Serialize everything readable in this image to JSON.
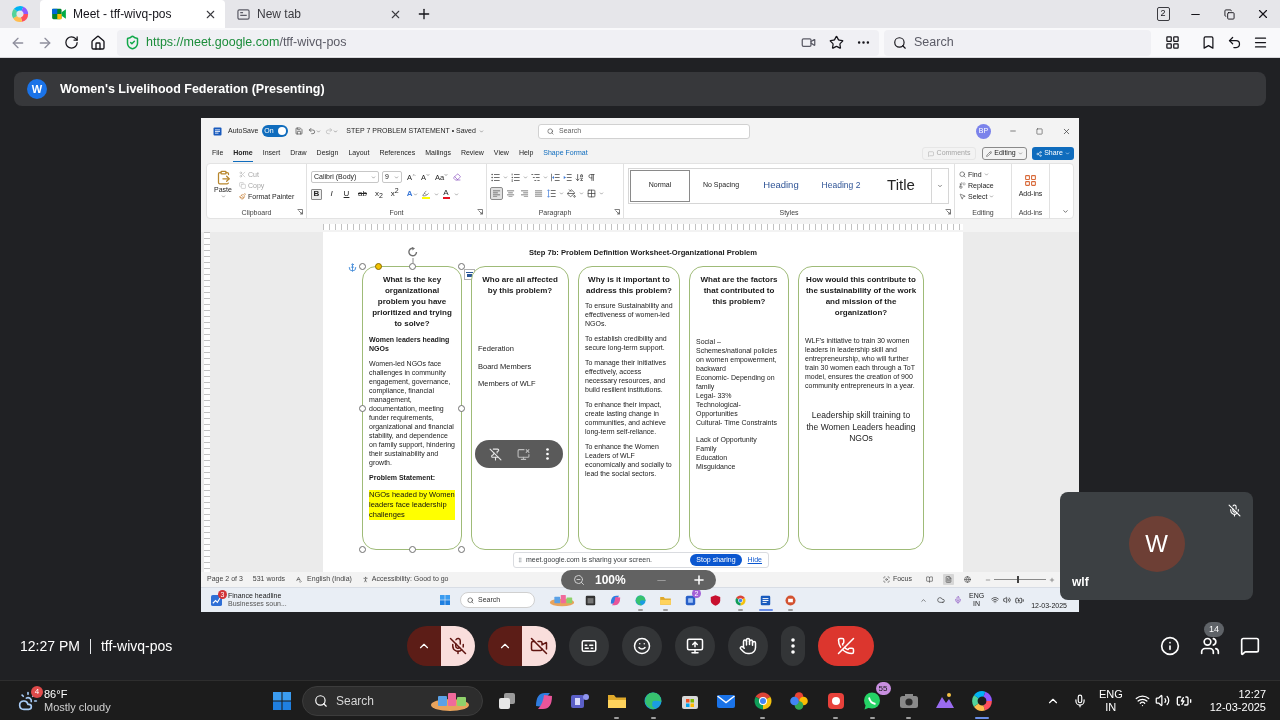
{
  "browser": {
    "tabs": [
      {
        "title": "Meet - tff-wivq-pos",
        "kind": "meet",
        "selected": true
      },
      {
        "title": "New tab",
        "kind": "blank",
        "selected": false
      }
    ],
    "tab_count": "2",
    "url_origin": "https://meet.google.com",
    "url_path": "/tff-wivq-pos",
    "search_placeholder": "Search"
  },
  "meeting": {
    "presenter_initial": "W",
    "title": "Women's Livelihood Federation (Presenting)",
    "time": "12:27 PM",
    "code": "tff-wivq-pos",
    "participant_count": "14",
    "controls": [
      {
        "kind": "mic",
        "on": false
      },
      {
        "kind": "camera",
        "on": false
      },
      {
        "kind": "captions",
        "on": false
      },
      {
        "kind": "reactions",
        "on": false
      },
      {
        "kind": "present",
        "on": false
      },
      {
        "kind": "hand",
        "on": false
      },
      {
        "kind": "more",
        "on": false
      }
    ]
  },
  "participant": {
    "initial": "W",
    "name": "wlf",
    "muted": true
  },
  "share_bar": {
    "message": "meet.google.com is sharing your screen.",
    "stop": "Stop sharing",
    "hide": "Hide"
  },
  "zoom_indicator": "100%",
  "word": {
    "autosave_label": "AutoSave",
    "autosave_on": true,
    "autosave_state": "On",
    "doc_title": "STEP 7 PROBLEM STATEMENT • Saved",
    "search_placeholder": "Search",
    "user_initials": "BP",
    "tabs": [
      {
        "label": "File",
        "selected": false,
        "contextual": false
      },
      {
        "label": "Home",
        "selected": true,
        "contextual": false
      },
      {
        "label": "Insert",
        "selected": false,
        "contextual": false
      },
      {
        "label": "Draw",
        "selected": false,
        "contextual": false
      },
      {
        "label": "Design",
        "selected": false,
        "contextual": false
      },
      {
        "label": "Layout",
        "selected": false,
        "contextual": false
      },
      {
        "label": "References",
        "selected": false,
        "contextual": false
      },
      {
        "label": "Mailings",
        "selected": false,
        "contextual": false
      },
      {
        "label": "Review",
        "selected": false,
        "contextual": false
      },
      {
        "label": "View",
        "selected": false,
        "contextual": false
      },
      {
        "label": "Help",
        "selected": false,
        "contextual": false
      },
      {
        "label": "Shape Format",
        "selected": false,
        "contextual": true
      }
    ],
    "comments": {
      "label": "Comments",
      "disabled": true
    },
    "mode": "Editing",
    "share": "Share",
    "clipboard": {
      "label": "Clipboard",
      "paste": "Paste",
      "tools": [
        {
          "label": "Cut",
          "kind": "cut",
          "disabled": true
        },
        {
          "label": "Copy",
          "kind": "copy",
          "disabled": true
        },
        {
          "label": "Format Painter",
          "kind": "painter",
          "disabled": false
        }
      ]
    },
    "font": {
      "label": "Font",
      "family": "Calibri (Body)",
      "size": "9",
      "size_tools": [
        {
          "label": "A",
          "kind": "grow"
        },
        {
          "label": "A",
          "kind": "shrink"
        },
        {
          "label": "Aa",
          "kind": "case"
        }
      ],
      "format": [
        {
          "label": "B",
          "selected": true
        },
        {
          "label": "I",
          "selected": false
        },
        {
          "label": "U",
          "selected": false
        },
        {
          "label": "ab",
          "selected": false
        },
        {
          "label": "x$_{2}$",
          "selected": false
        },
        {
          "label": "x$^{2}$",
          "selected": false
        }
      ],
      "effects": "A",
      "font_color": "A"
    },
    "paragraph": {
      "label": "Paragraph",
      "align": [
        {
          "kind": "left",
          "selected": true
        },
        {
          "kind": "center",
          "selected": false
        },
        {
          "kind": "right",
          "selected": false
        },
        {
          "kind": "justify",
          "selected": false
        }
      ]
    },
    "styles": {
      "label": "Styles",
      "items": [
        {
          "label": "Normal",
          "kind": "normal",
          "selected": true
        },
        {
          "label": "No Spacing",
          "kind": "no_spacing",
          "selected": false
        },
        {
          "label": "Heading",
          "kind": "heading1",
          "selected": false
        },
        {
          "label": "Heading 2",
          "kind": "heading2",
          "selected": false
        },
        {
          "label": "Title",
          "kind": "title",
          "selected": false
        }
      ]
    },
    "editing": {
      "label": "Editing",
      "items": [
        {
          "label": "Find",
          "kind": "find"
        },
        {
          "label": "Replace",
          "kind": "replace"
        },
        {
          "label": "Select",
          "kind": "select"
        }
      ]
    },
    "addins": {
      "label": "Add-ins",
      "button": "Add-ins"
    },
    "document": {
      "heading": "Step 7b: Problem Definition Worksheet-Organizational Problem",
      "columns": [
        {
          "question": "What is the key organizational problem you have prioritized and trying to solve?",
          "selected": true,
          "blocks": [
            {
              "kind": "subhead",
              "text": "Women leaders heading NGOs"
            },
            {
              "kind": "para",
              "text": "Women-led NGOs face challenges in community engagement, governance, compliance, financial management, documentation, meeting funder requirements, organizational and financial stability, and dependence on family support, hindering their sustainability and growth."
            },
            {
              "kind": "subhead",
              "text": "Problem Statement:"
            },
            {
              "kind": "highlight",
              "text": "NGOs headed by Women leaders face leadership challenges"
            }
          ]
        },
        {
          "question": "Who are all affected by this problem?",
          "selected": false,
          "blocks": [
            {
              "kind": "list",
              "items": [
                "Federation",
                "Board Members",
                "Members of WLF"
              ]
            }
          ]
        },
        {
          "question": "Why is it important to address this problem?",
          "selected": false,
          "blocks": [
            {
              "kind": "para",
              "text": "To ensure Sustainability and effectiveness of women-led NGOs."
            },
            {
              "kind": "para",
              "text": "To establish credibility and secure long-term support."
            },
            {
              "kind": "para",
              "text": "To manage their initiatives effectively, access necessary resources, and build resilient institutions."
            },
            {
              "kind": "para",
              "text": "To enhance their impact, create lasting change in communities, and achieve long-term self-reliance."
            },
            {
              "kind": "para",
              "text": "To enhance the Women Leaders of WLF economically and socially to lead the social sectors."
            }
          ]
        },
        {
          "question": "What are the factors that contributed to this problem?",
          "selected": false,
          "blocks": [
            {
              "kind": "lines",
              "items": [
                "Social –",
                "Schemes/national policies on women empowerment, backward",
                "Economic- Depending on family",
                "Legal- 33%",
                "Technological- Opportunities",
                "Cultural- Time Constraints"
              ]
            },
            {
              "kind": "lines",
              "items": [
                "Lack of Opportunity",
                "Family",
                "Education",
                "Misguidance"
              ]
            }
          ]
        },
        {
          "question": "How would this contribute to the sustainability of the work and mission of the organization?",
          "selected": false,
          "blocks": [
            {
              "kind": "note",
              "text": "WLF's initiative to train 30 women leaders in leadership skill and entrepreneurship, who will further train 30 women each through a ToT model, ensures the creation of 900 community entrepreneurs in a year."
            },
            {
              "kind": "callout",
              "text": "Leadership skill training to the Women Leaders heading NGOs"
            }
          ]
        }
      ]
    },
    "status": {
      "page": "Page 2 of 3",
      "words": "531 words",
      "language": "English (India)",
      "accessibility": "Accessibility: Good to go",
      "focus": "Focus",
      "views": [
        {
          "kind": "read",
          "selected": false
        },
        {
          "kind": "print",
          "selected": true
        },
        {
          "kind": "web",
          "selected": false
        }
      ],
      "zoom": {
        "level": 0.45
      }
    }
  },
  "inner_taskbar": {
    "news_badge": "3",
    "news_title": "Finance headline",
    "news_text": "Businesses soun...",
    "search_placeholder": "Search",
    "apps": [
      {
        "kind": "stack_dark",
        "open": false,
        "active": false
      },
      {
        "kind": "copilot",
        "open": false,
        "active": false
      },
      {
        "kind": "edge",
        "open": true,
        "active": false
      },
      {
        "kind": "folder",
        "open": true,
        "active": false
      },
      {
        "kind": "tile",
        "open": false,
        "active": false,
        "badge": "2"
      },
      {
        "kind": "shield",
        "open": false,
        "active": false
      },
      {
        "kind": "chrome",
        "open": true,
        "active": false
      },
      {
        "kind": "word",
        "open": true,
        "active": true
      },
      {
        "kind": "slides",
        "open": true,
        "active": false
      }
    ],
    "lang": "ENG",
    "region": "IN",
    "date": "12-03-2025"
  },
  "taskbar": {
    "weather_badge": "4",
    "temperature": "86°F",
    "condition": "Mostly cloudy",
    "search_placeholder": "Search",
    "apps": [
      {
        "kind": "stack",
        "open": false,
        "active": false
      },
      {
        "kind": "copilot",
        "open": false,
        "active": false
      },
      {
        "kind": "teams",
        "open": false,
        "active": false
      },
      {
        "kind": "folder",
        "open": true,
        "active": false
      },
      {
        "kind": "edge",
        "open": true,
        "active": false
      },
      {
        "kind": "store",
        "open": false,
        "active": false
      },
      {
        "kind": "mail",
        "open": false,
        "active": false
      },
      {
        "kind": "chrome",
        "open": true,
        "active": false
      },
      {
        "kind": "pinwheel",
        "open": false,
        "active": false
      },
      {
        "kind": "office",
        "open": true,
        "active": false
      },
      {
        "kind": "whatsapp",
        "open": true,
        "active": false,
        "badge": "55"
      },
      {
        "kind": "camera",
        "open": true,
        "active": false
      },
      {
        "kind": "mountains",
        "open": false,
        "active": false
      },
      {
        "kind": "ring",
        "open": true,
        "active": true
      }
    ],
    "lang": "ENG",
    "region": "IN",
    "time": "12:27",
    "date": "12-03-2025"
  }
}
